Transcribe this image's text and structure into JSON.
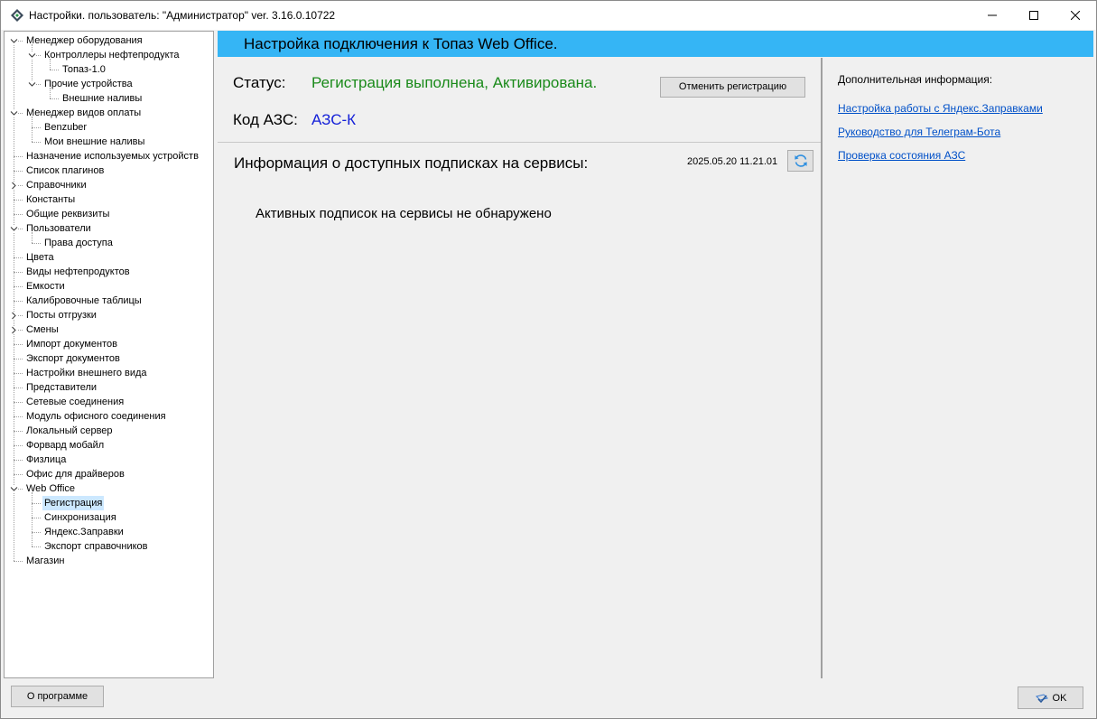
{
  "window": {
    "title": "Настройки. пользователь: \"Администратор\" ver. 3.16.0.10722"
  },
  "tree": {
    "items": [
      {
        "label": "Менеджер оборудования",
        "level": 0,
        "expander": "expanded"
      },
      {
        "label": "Контроллеры нефтепродукта",
        "level": 1,
        "expander": "expanded"
      },
      {
        "label": "Топаз-1.0",
        "level": 2,
        "expander": "none"
      },
      {
        "label": "Прочие устройства",
        "level": 1,
        "expander": "expanded"
      },
      {
        "label": "Внешние наливы",
        "level": 2,
        "expander": "none"
      },
      {
        "label": "Менеджер видов оплаты",
        "level": 0,
        "expander": "expanded"
      },
      {
        "label": "Benzuber",
        "level": 1,
        "expander": "none"
      },
      {
        "label": "Мои внешние наливы",
        "level": 1,
        "expander": "none"
      },
      {
        "label": "Назначение используемых устройств",
        "level": 0,
        "expander": "none"
      },
      {
        "label": "Список плагинов",
        "level": 0,
        "expander": "none"
      },
      {
        "label": "Справочники",
        "level": 0,
        "expander": "collapsed"
      },
      {
        "label": "Константы",
        "level": 0,
        "expander": "none"
      },
      {
        "label": "Общие реквизиты",
        "level": 0,
        "expander": "none"
      },
      {
        "label": "Пользователи",
        "level": 0,
        "expander": "expanded"
      },
      {
        "label": "Права доступа",
        "level": 1,
        "expander": "none"
      },
      {
        "label": "Цвета",
        "level": 0,
        "expander": "none"
      },
      {
        "label": "Виды нефтепродуктов",
        "level": 0,
        "expander": "none"
      },
      {
        "label": "Емкости",
        "level": 0,
        "expander": "none"
      },
      {
        "label": "Калибровочные таблицы",
        "level": 0,
        "expander": "none"
      },
      {
        "label": "Посты отгрузки",
        "level": 0,
        "expander": "collapsed"
      },
      {
        "label": "Смены",
        "level": 0,
        "expander": "collapsed"
      },
      {
        "label": "Импорт документов",
        "level": 0,
        "expander": "none"
      },
      {
        "label": "Экспорт документов",
        "level": 0,
        "expander": "none"
      },
      {
        "label": "Настройки внешнего вида",
        "level": 0,
        "expander": "none"
      },
      {
        "label": "Представители",
        "level": 0,
        "expander": "none"
      },
      {
        "label": "Сетевые соединения",
        "level": 0,
        "expander": "none"
      },
      {
        "label": "Модуль офисного соединения",
        "level": 0,
        "expander": "none"
      },
      {
        "label": "Локальный сервер",
        "level": 0,
        "expander": "none"
      },
      {
        "label": "Форвард мобайл",
        "level": 0,
        "expander": "none"
      },
      {
        "label": "Физлица",
        "level": 0,
        "expander": "none"
      },
      {
        "label": "Офис для драйверов",
        "level": 0,
        "expander": "none"
      },
      {
        "label": "Web Office",
        "level": 0,
        "expander": "expanded"
      },
      {
        "label": "Регистрация",
        "level": 1,
        "expander": "none",
        "selected": true
      },
      {
        "label": "Синхронизация",
        "level": 1,
        "expander": "none"
      },
      {
        "label": "Яндекс.Заправки",
        "level": 1,
        "expander": "none"
      },
      {
        "label": "Экспорт справочников",
        "level": 1,
        "expander": "none"
      },
      {
        "label": "Магазин",
        "level": 0,
        "expander": "none"
      }
    ]
  },
  "header": {
    "title": "Настройка подключения к Топаз Web Office."
  },
  "status": {
    "label": "Статус:",
    "value": "Регистрация выполнена, Активирована.",
    "value_color": "#1a8a1a",
    "unregister_button": "Отменить регистрацию"
  },
  "station": {
    "label": "Код АЗС:",
    "value": "АЗС-К",
    "value_color": "#1420d8"
  },
  "subscriptions": {
    "title": "Информация о доступных подписках на сервисы:",
    "date": "2025.05.20 11.21.01",
    "refresh_icon": "refresh-icon",
    "empty_message": "Активных подписок на сервисы не обнаружено"
  },
  "info": {
    "title": "Дополнительная информация:",
    "links": [
      "Настройка работы с Яндекс.Заправками",
      "Руководство для Телеграм-Бота",
      "Проверка состояния АЗС"
    ]
  },
  "footer": {
    "about_button": "О программе",
    "ok_button": "OK"
  },
  "colors": {
    "header_accent": "#35b5f5",
    "selection": "#cce8ff",
    "link": "#0050c8"
  }
}
